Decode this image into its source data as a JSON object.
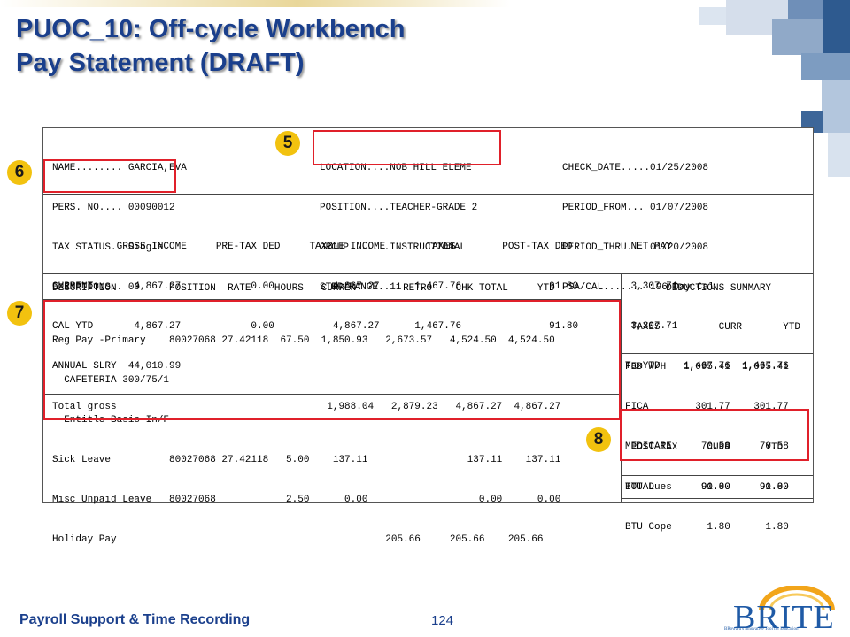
{
  "title": {
    "line1": "PUOC_10: Off-cycle Workbench",
    "line2": "Pay Statement (DRAFT)"
  },
  "statement": {
    "header_left": [
      "NAME........ GARCIA,EVA",
      "PERS. NO.... 00090012",
      "TAX STATUS.. Single",
      "EXEMPTIONS.. 00"
    ],
    "header_mid": [
      "LOCATION....NOB HILL ELEME",
      "POSITION....TEACHER-GRADE 2",
      "GROUP.......INSTRUCTIONAL",
      "STEP/RANGE..11"
    ],
    "header_right": [
      "CHECK_DATE.....01/25/2008",
      "PERIOD_FROM... 01/07/2008",
      "PERIOD_THRU... 01/20/2008",
      "PSA/CAL....... 196 Day Cal"
    ],
    "summary": [
      "           GROSS INCOME     PRE-TAX DED     TAXBLE INCOME       TAXES        POST-TAX DED          NET PAY",
      "CURRENT       4,867.27            0.00          4,867.27      1,467.76               91.80         3,307.71",
      "CAL YTD       4,867.27            0.00          4,867.27      1,467.76               91.80         3,307.71",
      "ANNUAL SLRY  44,010.99"
    ],
    "earnings_header": "DESCRIPTION         POSITION  RATE    HOURS   CURRENT       RETRO    CHK TOTAL     YTD",
    "earnings": [
      "Reg Pay -Primary    80027068 27.42118  67.50  1,850.93   2,673.57   4,524.50  4,524.50",
      "  CAFETERIA 300/75/1",
      "  Entitle Basic In/F",
      "Sick Leave          80027068 27.42118   5.00    137.11                 137.11    137.11",
      "Misc Unpaid Leave   80027068            2.50      0.00                   0.00      0.00",
      "Holiday Pay                                              205.66     205.66    205.66"
    ],
    "total_gross": "Total gross                                    1,988.04   2,879.23   4,867.27  4,867.27",
    "deductions_title": "       DEDUCTIONS SUMMARY",
    "taxes": [
      " TAXES          CURR       YTD",
      "FED W/H   1,095.41  1,095.41",
      "FICA        301.77    301.77",
      "MEDICARE     70.58     70.58"
    ],
    "tax_ytd": "TaxYTD    1,467.76  1,467.76",
    "post_tax": [
      " POST-TAX     CURR      YTD",
      "BTU Dues     90.00     90.00",
      "BTU Cope      1.80      1.80"
    ],
    "total": "TOTAL        91.80     91.80"
  },
  "callouts": {
    "c5": "5",
    "c6": "6",
    "c7": "7",
    "c8": "8"
  },
  "footer": {
    "left": "Payroll Support & Time Recording",
    "page": "124"
  },
  "logo": {
    "text": "BRITE",
    "tagline": "BRoward's Innovative Tool for Education"
  },
  "colors": {
    "title": "#1a3f8c",
    "callout": "#f2c20f",
    "highlight": "#e0202a"
  }
}
